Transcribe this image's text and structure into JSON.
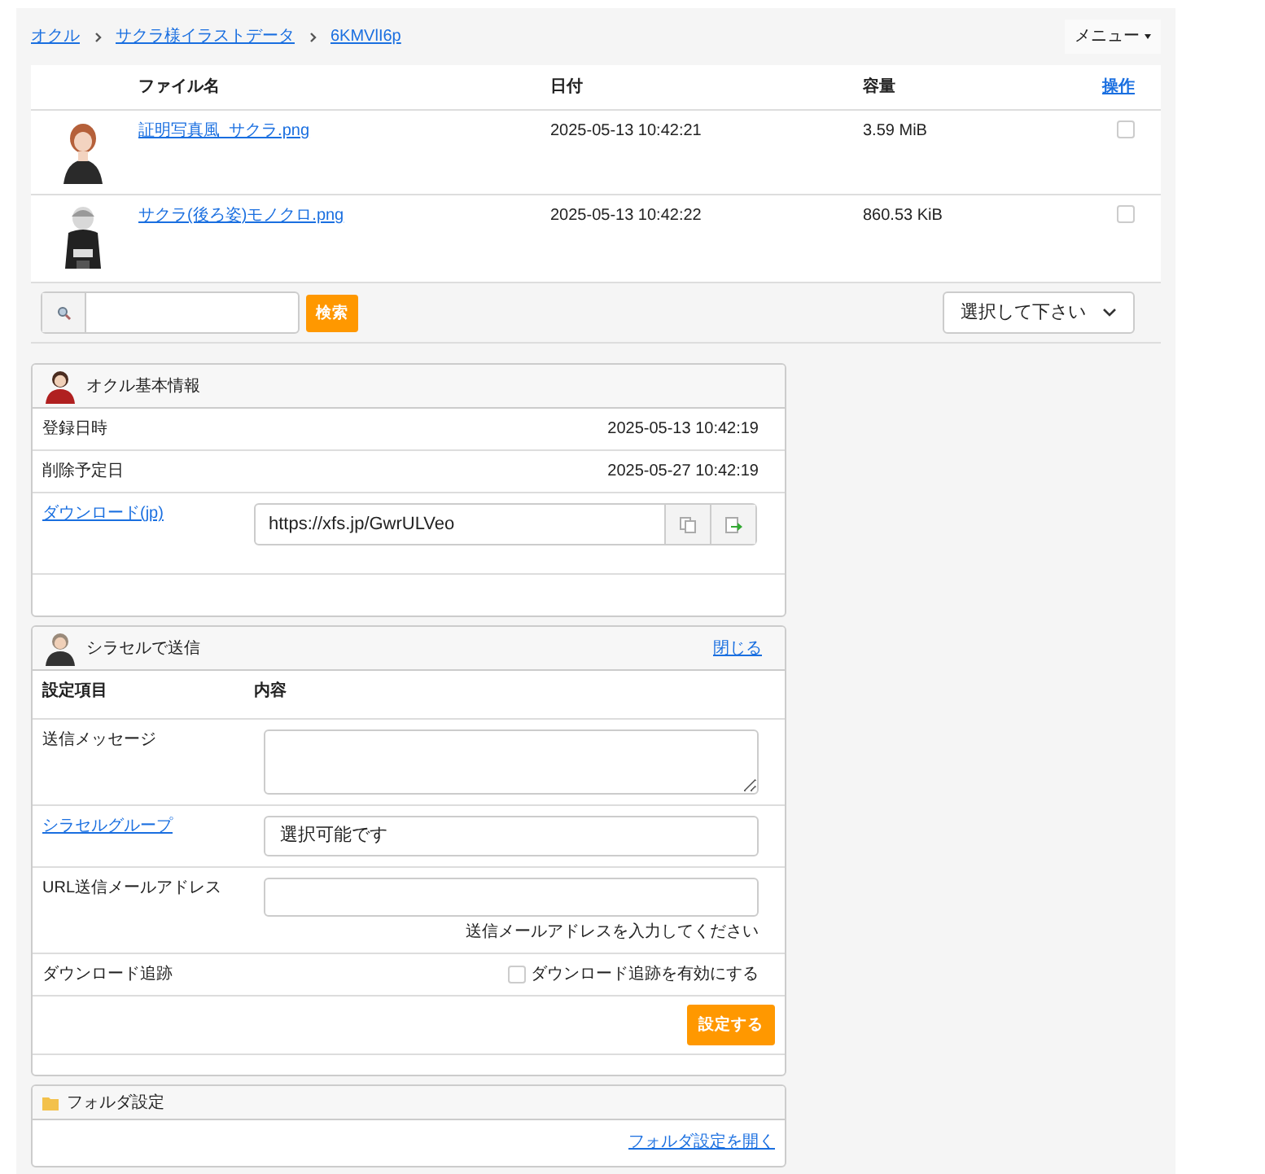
{
  "breadcrumbs": [
    {
      "label": "オクル"
    },
    {
      "label": "サクラ様イラストデータ"
    },
    {
      "label": "6KMVlI6p"
    }
  ],
  "menu": {
    "label": "メニュー"
  },
  "file_table": {
    "columns": [
      {
        "label": "ファイル名",
        "kind": "text"
      },
      {
        "label": "日付",
        "kind": "text"
      },
      {
        "label": "容量",
        "kind": "text"
      },
      {
        "label": "操作",
        "kind": "link"
      }
    ],
    "rows": [
      {
        "name": "証明写真風_サクラ.png",
        "date": "2025-05-13 10:42:21",
        "size": "3.59 MiB",
        "checked": false
      },
      {
        "name": "サクラ(後ろ姿)モノクロ.png",
        "date": "2025-05-13 10:42:22",
        "size": "860.53 KiB",
        "checked": false
      }
    ]
  },
  "search": {
    "button": "検索"
  },
  "sort_select": {
    "value": "選択して下さい"
  },
  "info_panel": {
    "title": "オクル基本情報",
    "rows": [
      {
        "kind": "text",
        "label": "登録日時",
        "value": "2025-05-13 10:42:19"
      },
      {
        "kind": "text",
        "label": "削除予定日",
        "value": "2025-05-27 10:42:19"
      },
      {
        "kind": "url",
        "label": "ダウンロード(jp)",
        "value": "https://xfs.jp/GwrULVeo"
      }
    ]
  },
  "send_panel": {
    "title": "シラセルで送信",
    "close_link": "閉じる",
    "header": [
      "設定項目",
      "内容"
    ],
    "rows": [
      {
        "kind": "textarea",
        "label": "送信メッセージ"
      },
      {
        "kind": "select",
        "label": "シラセルグループ",
        "value": "選択可能です"
      },
      {
        "kind": "email",
        "label": "URL送信メールアドレス",
        "hint": "送信メールアドレスを入力してください"
      },
      {
        "kind": "checkbox",
        "label": "ダウンロード追跡",
        "option": "ダウンロード追跡を有効にする",
        "checked": false
      }
    ],
    "submit": "設定する"
  },
  "folder_panel": {
    "title": "フォルダ設定",
    "link": "フォルダ設定を開く"
  }
}
